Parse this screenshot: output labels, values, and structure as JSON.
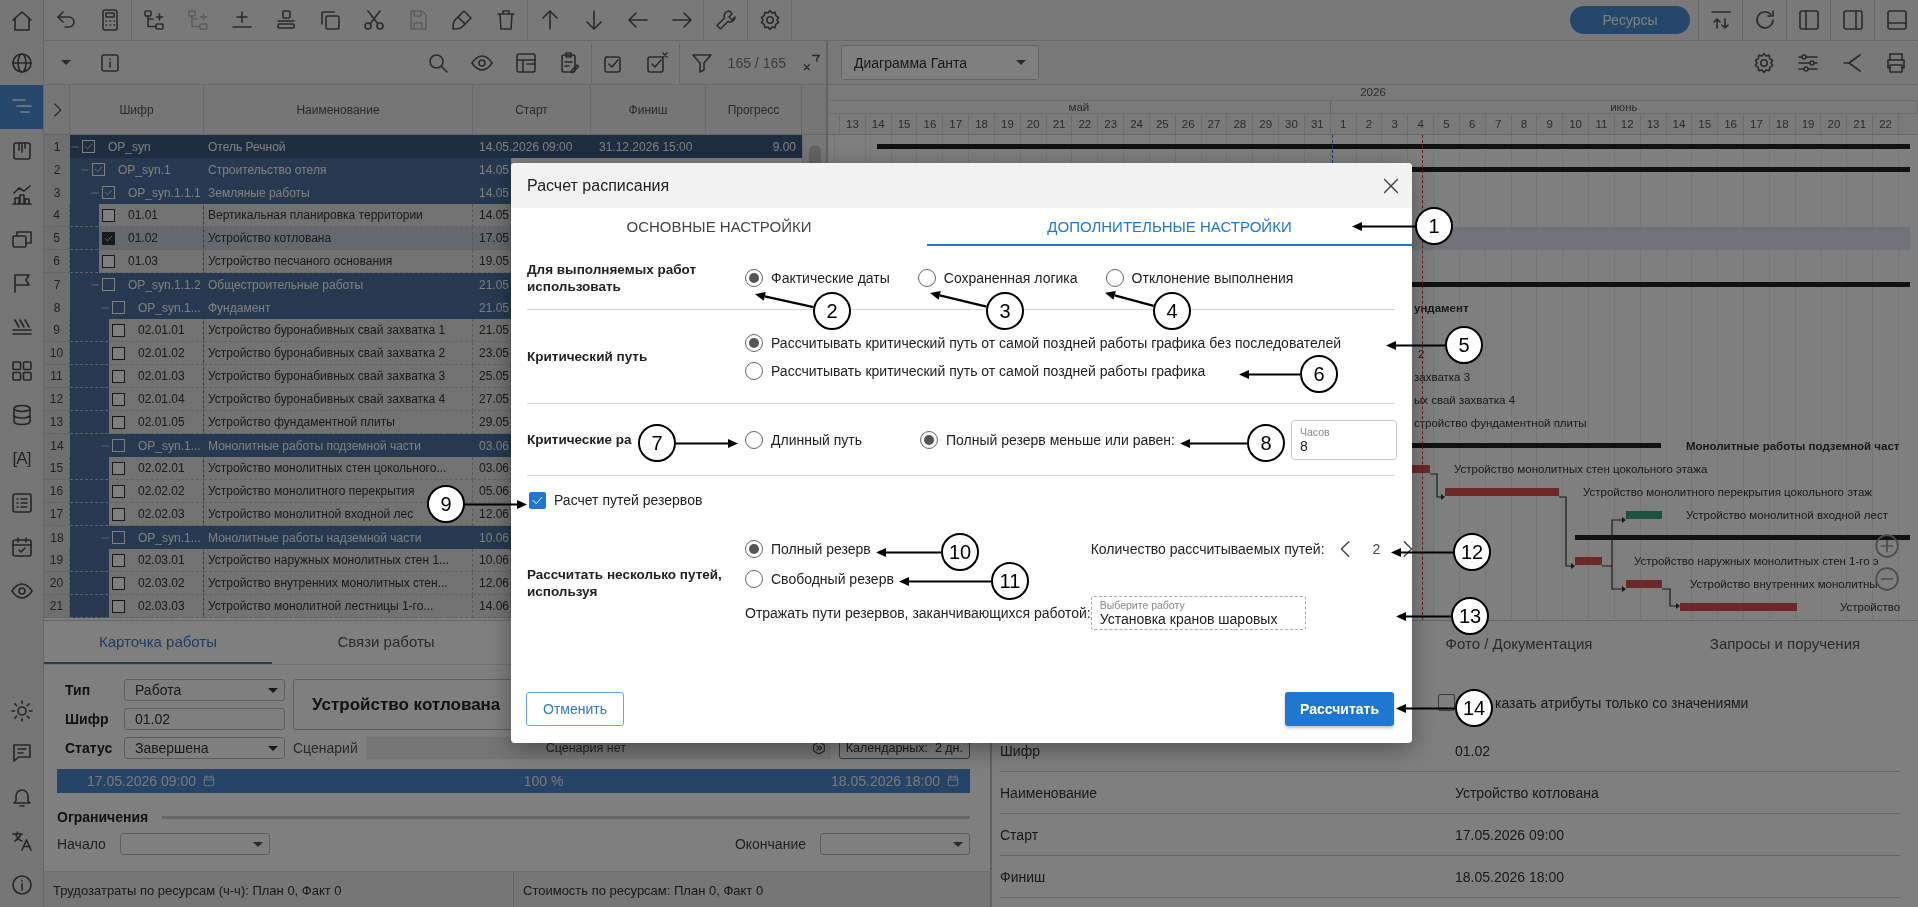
{
  "rail": {
    "items": [
      {
        "selected": false
      },
      {
        "selected": false
      },
      {
        "selected": true
      },
      {
        "selected": false
      },
      {
        "selected": false
      },
      {
        "selected": false
      },
      {
        "selected": false
      },
      {
        "selected": false
      },
      {
        "selected": false
      },
      {
        "selected": false
      },
      {
        "glyph": "[A]",
        "selected": false
      },
      {
        "selected": false
      },
      {
        "selected": false
      },
      {
        "selected": false
      }
    ]
  },
  "toolbar": {
    "buttons": [
      {
        "disabled": false
      },
      {
        "disabled": false
      },
      {
        "disabled": false
      },
      {
        "disabled": true
      },
      {
        "disabled": false
      },
      {
        "disabled": false
      },
      {
        "disabled": false
      },
      {
        "disabled": false
      },
      {
        "disabled": true
      },
      {
        "disabled": false
      },
      {
        "disabled": false
      },
      {
        "disabled": false
      },
      {
        "disabled": false
      },
      {
        "disabled": false
      },
      {
        "disabled": false
      },
      {
        "disabled": false
      },
      {
        "disabled": false
      }
    ],
    "resources_button": "Ресурсы"
  },
  "table_toolbar": {
    "filter_count": "165 / 165"
  },
  "table": {
    "columns": [
      "Шифр",
      "Наименование",
      "Старт",
      "Финиш",
      "Прогресс"
    ],
    "rows": [
      {
        "number": "1",
        "code": "OP_syn",
        "name": "Отель Речной",
        "start": "14.05.2026 09:00",
        "finish": "31.12.2026 15:00",
        "progress": "9.00",
        "checked": true,
        "selected": false,
        "expanded": true,
        "children": [
          {
            "number": "2",
            "code": "OP_syn.1",
            "name": "Строительство отеля",
            "start": "14.05",
            "checked": true,
            "selected": false,
            "expanded": true,
            "children": [
              {
                "number": "3",
                "code": "OP_syn.1.1.1",
                "name": "Земляные работы",
                "start": "14.05",
                "checked": true,
                "selected": false,
                "expanded": true,
                "children": [
                  {
                    "number": "4",
                    "code": "01.01",
                    "name": "Вертикальная планировка территории",
                    "start": "14.05",
                    "checked": false,
                    "selected": false
                  },
                  {
                    "number": "5",
                    "code": "01.02",
                    "name": "Устройство котлована",
                    "start": "17.05",
                    "checked": true,
                    "selected": true
                  },
                  {
                    "number": "6",
                    "code": "01.03",
                    "name": "Устройство песчаного основания",
                    "start": "19.05",
                    "checked": false,
                    "selected": false
                  }
                ]
              },
              {
                "number": "7",
                "code": "OP_syn.1.1.2",
                "name": "Общестроительные работы",
                "start": "21.05",
                "checked": false,
                "selected": false,
                "expanded": true,
                "children": [
                  {
                    "number": "8",
                    "code": "OP_syn.1...",
                    "name": "Фундамент",
                    "start": "21.05",
                    "checked": false,
                    "selected": false,
                    "expanded": true,
                    "children": [
                      {
                        "number": "9",
                        "code": "02.01.01",
                        "name": "Устройство буронабивных свай захватка 1",
                        "start": "21.05",
                        "checked": false,
                        "selected": false
                      },
                      {
                        "number": "10",
                        "code": "02.01.02",
                        "name": "Устройство буронабивных свай захватка 2",
                        "start": "23.05",
                        "checked": false,
                        "selected": false
                      },
                      {
                        "number": "11",
                        "code": "02.01.03",
                        "name": "Устройство буронабивных свай захватка 3",
                        "start": "25.05",
                        "checked": false,
                        "selected": false
                      },
                      {
                        "number": "12",
                        "code": "02.01.04",
                        "name": "Устройство буронабивных свай захватка 4",
                        "start": "27.05",
                        "checked": false,
                        "selected": false
                      },
                      {
                        "number": "13",
                        "code": "02.01.05",
                        "name": "Устройство фундаментной плиты",
                        "start": "29.05",
                        "checked": false,
                        "selected": false
                      }
                    ]
                  },
                  {
                    "number": "14",
                    "code": "OP_syn.1...",
                    "name": "Монолитные работы подземной части",
                    "start": "03.06",
                    "checked": false,
                    "selected": false,
                    "expanded": true,
                    "children": [
                      {
                        "number": "15",
                        "code": "02.02.01",
                        "name": "Устройство монолитных стен цокольного...",
                        "start": "03.06",
                        "checked": false,
                        "selected": false
                      },
                      {
                        "number": "16",
                        "code": "02.02.02",
                        "name": "Устройство монолитного перекрытия",
                        "start": "05.06",
                        "checked": false,
                        "selected": false
                      },
                      {
                        "number": "17",
                        "code": "02.02.03",
                        "name": "Устройство монолитной входной лес",
                        "start": "12.06",
                        "checked": false,
                        "selected": false
                      }
                    ]
                  },
                  {
                    "number": "18",
                    "code": "OP_syn.1...",
                    "name": "Монолитные работы надземной части",
                    "start": "10.06",
                    "checked": false,
                    "selected": false,
                    "expanded": true,
                    "children": [
                      {
                        "number": "19",
                        "code": "02.03.01",
                        "name": "Устройство наружных монолитных стен 1...",
                        "start": "10.06",
                        "checked": false,
                        "selected": false
                      },
                      {
                        "number": "20",
                        "code": "02.03.02",
                        "name": "Устройство внутренних монолитных стен...",
                        "start": "12.06",
                        "checked": false,
                        "selected": false
                      },
                      {
                        "number": "21",
                        "code": "02.03.03",
                        "name": "Устройство монолитной лестницы 1-го...",
                        "start": "14.06",
                        "checked": false,
                        "selected": false
                      }
                    ]
                  }
                ]
              }
            ]
          }
        ]
      }
    ]
  },
  "gantt_toolbar": {
    "view": "Диаграмма Ганта"
  },
  "gantt": {
    "year": "2026",
    "months": [
      {
        "label": "май",
        "days": [
          "13",
          "14",
          "15",
          "16",
          "17",
          "18",
          "19",
          "20",
          "21",
          "22",
          "23",
          "24",
          "25",
          "26",
          "27",
          "28",
          "29",
          "30",
          "31"
        ]
      },
      {
        "label": "июнь",
        "days": [
          "1",
          "2",
          "3",
          "4",
          "5",
          "6",
          "7",
          "8",
          "9",
          "10",
          "11",
          "12",
          "13",
          "14",
          "15",
          "16",
          "17",
          "18",
          "19",
          "20",
          "21",
          "22"
        ]
      }
    ],
    "items": [
      {
        "kind": "summary"
      },
      {
        "kind": "summary"
      },
      {
        "kind": "summary"
      },
      {
        "kind": "summary",
        "label": "ундамент"
      },
      {
        "kind": "task",
        "label": "2"
      },
      {
        "kind": "task",
        "label": "захватка 3"
      },
      {
        "kind": "task",
        "label": "ых свай захватка 4"
      },
      {
        "kind": "task",
        "label": "стройство фундаментной плиты"
      },
      {
        "kind": "summary",
        "label": "Монолитные работы подземной част"
      },
      {
        "kind": "critical",
        "label": "Устройство монолитных стен цокольного этажа"
      },
      {
        "kind": "critical",
        "label": "Устройство монолитного перекрытия цокольного этаж"
      },
      {
        "kind": "normal",
        "label": "Устройство монолитной входной лест"
      },
      {
        "kind": "summary"
      },
      {
        "kind": "critical",
        "label": "Устройство наружных монолитных стен 1-го э"
      },
      {
        "kind": "critical",
        "label": "Устройство внутренних монолитны"
      },
      {
        "kind": "critical",
        "label": "Устройство"
      }
    ]
  },
  "work_card": {
    "tabs": [
      {
        "label": "Карточка работы",
        "selected": true
      },
      {
        "label": "Связи работы",
        "selected": false
      }
    ],
    "type_label": "Тип",
    "type": "Работа",
    "code_label": "Шифр",
    "code": "01.02",
    "name": "Устройство котлована",
    "status_label": "Статус",
    "status": "Завершена",
    "scenario_label": "Сценарий",
    "scenario": "Сценария нет",
    "calendar": "Календарных:  2 дн.",
    "start": "17.05.2026 09:00",
    "progress": "100 %",
    "level": 1,
    "finish": "18.05.2026 18:00",
    "constraints_title": "Ограничения",
    "start_constraint_label": "Начало",
    "finish_constraint_label": "Окончание",
    "labor": "Трудозатраты по ресурсам (ч-ч): План 0, Факт 0",
    "cost": "Стоимость по ресурсам: План 0, Факт 0"
  },
  "details": {
    "tabs": [
      {
        "label": "Фото / Документация",
        "selected": false
      },
      {
        "label": "Запросы и поручения",
        "selected": false
      }
    ],
    "only_filled": {
      "label": "казать атрибуты только со значениями",
      "checked": false
    },
    "properties": [
      {
        "name": "Шифр",
        "value": "01.02"
      },
      {
        "name": "Наименование",
        "value": "Устройство котлована"
      },
      {
        "name": "Старт",
        "value": "17.05.2026 09:00"
      },
      {
        "name": "Финиш",
        "value": "18.05.2026 18:00"
      }
    ]
  },
  "dialog": {
    "title": "Расчет расписания",
    "tabs": [
      {
        "label": "ОСНОВНЫЕ НАСТРОЙКИ",
        "selected": false
      },
      {
        "label": "ДОПОЛНИТЕЛЬНЫЕ НАСТРОЙКИ",
        "selected": true
      }
    ],
    "use_for_in_progress": {
      "label": "Для выполняемых работ использовать",
      "options": [
        {
          "label": "Фактические даты",
          "selected": true
        },
        {
          "label": "Сохраненная логика",
          "selected": false
        },
        {
          "label": "Отклонение выполнения",
          "selected": false
        }
      ]
    },
    "critical_path": {
      "label": "Критический путь",
      "options": [
        {
          "label": "Рассчитывать критический путь от самой поздней работы графика без последователей",
          "selected": true
        },
        {
          "label": "Рассчитывать критический путь от самой поздней работы графика",
          "selected": false
        }
      ]
    },
    "critical_tasks": {
      "label": "Критические ра",
      "options": [
        {
          "label": "Длинный путь",
          "selected": false
        },
        {
          "label": "Полный резерв меньше или равен:",
          "selected": true
        }
      ],
      "hours": {
        "label": "Часов",
        "value": "8"
      }
    },
    "float_paths": {
      "label": "Расчет путей резервов",
      "checked": true
    },
    "multiple_paths": {
      "label": "Рассчитать несколько путей, используя",
      "options": [
        {
          "label": "Полный резерв",
          "selected": true
        },
        {
          "label": "Свободный резерв",
          "selected": false
        }
      ],
      "count_label": "Количество рассчитываемых путей:",
      "count": "2",
      "end_label": "Отражать пути резервов, заканчивающихся работой:",
      "end_task": {
        "label": "Выберите работу",
        "value": "Установка кранов шаровых"
      }
    },
    "buttons": [
      {
        "label": "Отменить",
        "kind": "secondary"
      },
      {
        "label": "Рассчитать",
        "kind": "primary"
      }
    ]
  },
  "callouts": [
    "1",
    "2",
    "3",
    "4",
    "5",
    "6",
    "7",
    "8",
    "9",
    "10",
    "11",
    "12",
    "13",
    "14"
  ]
}
